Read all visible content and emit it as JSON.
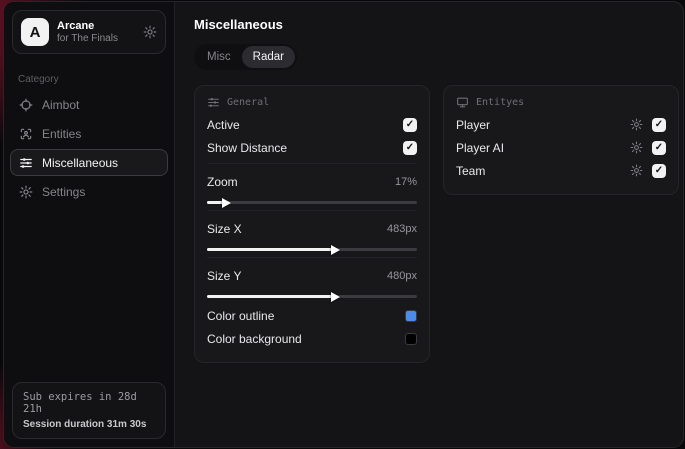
{
  "colors": {
    "accent_red": "#d61f45",
    "swatch_blue": "#4d8be8",
    "swatch_black": "#000000"
  },
  "window": {
    "brand": {
      "name": "Arcane",
      "subtitle": "for The Finals"
    },
    "sidebar": {
      "category_label": "Category",
      "items": [
        {
          "label": "Aimbot"
        },
        {
          "label": "Entities"
        },
        {
          "label": "Miscellaneous"
        },
        {
          "label": "Settings"
        }
      ],
      "footer": {
        "sub_expires": "Sub expires in 28d 21h",
        "session_duration": "Session duration 31m 30s"
      }
    },
    "main": {
      "title": "Miscellaneous",
      "tabs": [
        {
          "label": "Misc",
          "active": false
        },
        {
          "label": "Radar",
          "active": true
        }
      ],
      "general": {
        "title": "General",
        "toggles": [
          {
            "label": "Active",
            "checked": true
          },
          {
            "label": "Show Distance",
            "checked": true
          }
        ],
        "sliders": [
          {
            "label": "Zoom",
            "value": "17%",
            "percent": 8
          },
          {
            "label": "Size X",
            "value": "483px",
            "percent": 60
          },
          {
            "label": "Size Y",
            "value": "480px",
            "percent": 60
          }
        ],
        "color_rows": [
          {
            "label": "Color outline",
            "hex": "#4d8be8"
          },
          {
            "label": "Color background",
            "hex": "#000000"
          }
        ]
      },
      "entities": {
        "title": "Entityes",
        "rows": [
          {
            "label": "Player",
            "checked": true
          },
          {
            "label": "Player AI",
            "checked": true
          },
          {
            "label": "Team",
            "checked": true
          }
        ]
      }
    }
  }
}
